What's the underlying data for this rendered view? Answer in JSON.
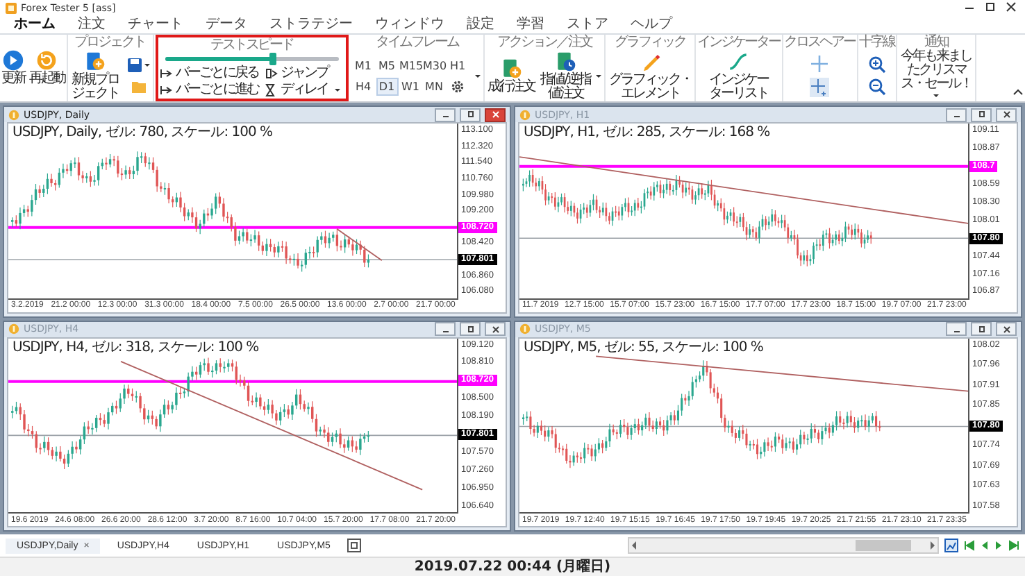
{
  "window": {
    "title": "Forex Tester 5  [ass]"
  },
  "menu_tabs": [
    {
      "label": "ホーム",
      "selected": true
    },
    {
      "label": "注文",
      "selected": false
    },
    {
      "label": "チャート",
      "selected": false
    },
    {
      "label": "データ",
      "selected": false
    },
    {
      "label": "ストラテジー",
      "selected": false
    },
    {
      "label": "ウィンドウ",
      "selected": false
    },
    {
      "label": "設定",
      "selected": false
    },
    {
      "label": "学習",
      "selected": false
    },
    {
      "label": "ストア",
      "selected": false
    },
    {
      "label": "ヘルプ",
      "selected": false
    }
  ],
  "ribbon": {
    "main": [
      {
        "label": "更新",
        "kind": "play"
      },
      {
        "label": "再起動",
        "kind": "restart"
      }
    ],
    "project": {
      "title": "プロジェクト",
      "new_label": "新規プロジェクト"
    },
    "test_speed": {
      "title": "テストスピード",
      "level": 0.62,
      "buttons": [
        {
          "label": "バーごとに戻る",
          "kind": "back"
        },
        {
          "label": "ジャンプ",
          "kind": "jump"
        },
        {
          "label": "バーごとに進む",
          "kind": "forward"
        },
        {
          "label": "ディレイ",
          "kind": "delay"
        }
      ]
    },
    "timeframes": {
      "title": "タイムフレーム",
      "items": [
        {
          "label": "M1",
          "selected": false
        },
        {
          "label": "M5",
          "selected": false
        },
        {
          "label": "M15",
          "selected": false
        },
        {
          "label": "M30",
          "selected": false
        },
        {
          "label": "H1",
          "selected": false
        },
        {
          "label": "H4",
          "selected": false
        },
        {
          "label": "D1",
          "selected": true
        },
        {
          "label": "W1",
          "selected": false
        },
        {
          "label": "MN",
          "selected": false
        }
      ]
    },
    "orders": {
      "title": "アクション／注文",
      "buttons": [
        {
          "label": "成行注文",
          "kind": "market"
        },
        {
          "label": "指値/逆指値注文",
          "kind": "pending"
        }
      ]
    },
    "graphics": {
      "title": "グラフィック",
      "button": "グラフィック・エレメント"
    },
    "indicators": {
      "title": "インジケーター",
      "button": "インジケーターリスト"
    },
    "crosshair": {
      "title": "クロスヘアー",
      "buttons": [
        {
          "kind": "cross",
          "selected": false
        },
        {
          "kind": "cross-plus",
          "selected": true
        }
      ]
    },
    "zoom": {
      "title": "十字線"
    },
    "notice": {
      "title": "通知",
      "text": "今年も来ましたクリスマス・セール！"
    }
  },
  "charts": [
    {
      "title": "USDJPY, Daily",
      "active": true,
      "info": "USDJPY, Daily, ゼル: 780, スケール: 100 %",
      "y_axis": [
        {
          "text": "113.100",
          "kind": "tick"
        },
        {
          "text": "112.320",
          "kind": "tick"
        },
        {
          "text": "111.540",
          "kind": "tick"
        },
        {
          "text": "110.760",
          "kind": "tick"
        },
        {
          "text": "109.980",
          "kind": "tick"
        },
        {
          "text": "109.200",
          "kind": "tick"
        },
        {
          "text": "108.720",
          "kind": "level",
          "color": "#ff00ff"
        },
        {
          "text": "108.420",
          "kind": "tick"
        },
        {
          "text": "107.801",
          "kind": "price",
          "color": "#000000"
        },
        {
          "text": "106.860",
          "kind": "tick"
        },
        {
          "text": "106.080",
          "kind": "tick"
        }
      ],
      "x_axis": [
        "3.2.2019",
        "21.2 00:00",
        "12.3 00:00",
        "31.3 00:00",
        "18.4 00:00",
        "7.5 00:00",
        "26.5 00:00",
        "13.6 00:00",
        "2.7 00:00",
        "21.7 00:00"
      ]
    },
    {
      "title": "USDJPY, H1",
      "active": false,
      "info": "USDJPY, H1, ゼル: 285, スケール: 168 %",
      "y_axis": [
        {
          "text": "109.11",
          "kind": "tick"
        },
        {
          "text": "108.87",
          "kind": "tick"
        },
        {
          "text": "108.7",
          "kind": "level",
          "color": "#ff00ff"
        },
        {
          "text": "108.59",
          "kind": "tick"
        },
        {
          "text": "108.30",
          "kind": "tick"
        },
        {
          "text": "108.01",
          "kind": "tick"
        },
        {
          "text": "107.80",
          "kind": "price",
          "color": "#000000"
        },
        {
          "text": "107.44",
          "kind": "tick"
        },
        {
          "text": "107.16",
          "kind": "tick"
        },
        {
          "text": "106.87",
          "kind": "tick"
        }
      ],
      "x_axis": [
        "11.7 2019",
        "12.7 15:00",
        "15.7 07:00",
        "15.7 23:00",
        "16.7 15:00",
        "17.7 07:00",
        "17.7 23:00",
        "18.7 15:00",
        "19.7 07:00",
        "21.7 23:00"
      ]
    },
    {
      "title": "USDJPY, H4",
      "active": false,
      "info": "USDJPY, H4, ゼル: 318, スケール: 100 %",
      "y_axis": [
        {
          "text": "109.120",
          "kind": "tick"
        },
        {
          "text": "108.810",
          "kind": "tick"
        },
        {
          "text": "108.720",
          "kind": "level",
          "color": "#ff00ff"
        },
        {
          "text": "108.500",
          "kind": "tick"
        },
        {
          "text": "108.190",
          "kind": "tick"
        },
        {
          "text": "107.801",
          "kind": "price",
          "color": "#000000"
        },
        {
          "text": "107.570",
          "kind": "tick"
        },
        {
          "text": "107.260",
          "kind": "tick"
        },
        {
          "text": "106.950",
          "kind": "tick"
        },
        {
          "text": "106.640",
          "kind": "tick"
        }
      ],
      "x_axis": [
        "19.6 2019",
        "24.6 08:00",
        "26.6 20:00",
        "28.6 12:00",
        "3.7 20:00",
        "8.7 16:00",
        "10.7 04:00",
        "15.7 20:00",
        "17.7 08:00",
        "21.7 20:00"
      ]
    },
    {
      "title": "USDJPY, M5",
      "active": false,
      "info": "USDJPY, M5, ゼル: 55, スケール: 100 %",
      "y_axis": [
        {
          "text": "108.02",
          "kind": "tick"
        },
        {
          "text": "107.96",
          "kind": "tick"
        },
        {
          "text": "107.91",
          "kind": "tick"
        },
        {
          "text": "107.85",
          "kind": "tick"
        },
        {
          "text": "107.80",
          "kind": "price",
          "color": "#000000"
        },
        {
          "text": "107.74",
          "kind": "tick"
        },
        {
          "text": "107.69",
          "kind": "tick"
        },
        {
          "text": "107.63",
          "kind": "tick"
        },
        {
          "text": "107.58",
          "kind": "tick"
        }
      ],
      "x_axis": [
        "19.7 2019",
        "19.7 12:40",
        "19.7 15:15",
        "19.7 16:45",
        "19.7 17:50",
        "19.7 19:45",
        "19.7 20:25",
        "21.7 21:55",
        "21.7 23:10",
        "21.7 23:35"
      ]
    }
  ],
  "chart_tabs": {
    "close_mark": "×",
    "items": [
      {
        "label": "USDJPY,Daily",
        "selected": true
      },
      {
        "label": "USDJPY,H4",
        "selected": false
      },
      {
        "label": "USDJPY,H1",
        "selected": false
      },
      {
        "label": "USDJPY,M5",
        "selected": false
      }
    ]
  },
  "status_bar": {
    "datetime": "2019.07.22 00:44 (月曜日)"
  }
}
